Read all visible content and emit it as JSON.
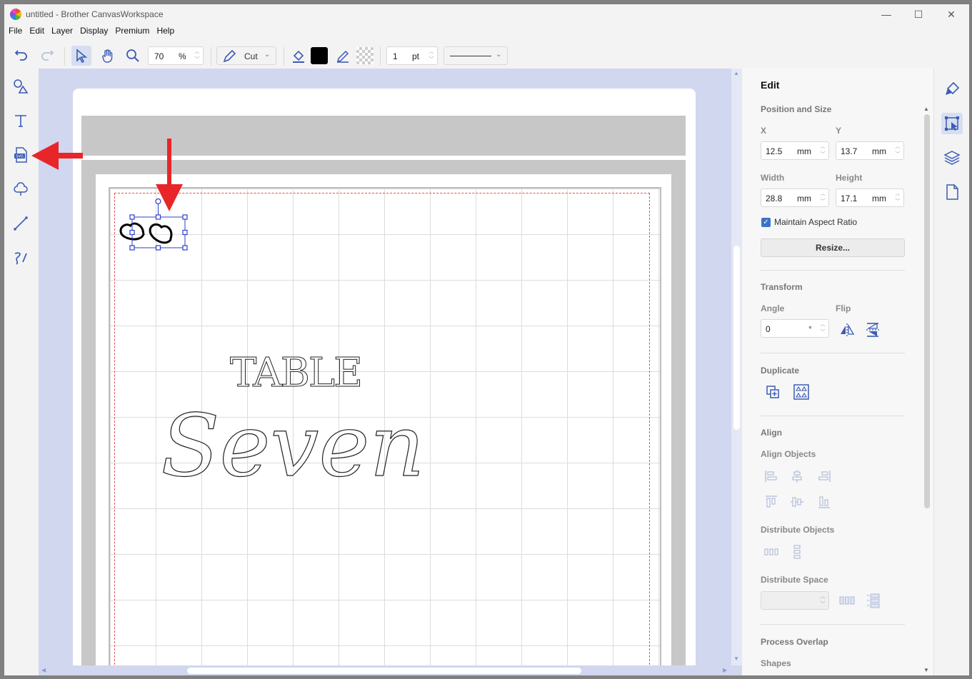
{
  "window": {
    "title": "untitled - Brother CanvasWorkspace",
    "minimize": "—",
    "maximize": "☐",
    "close": "✕"
  },
  "menu": [
    "File",
    "Edit",
    "Layer",
    "Display",
    "Premium",
    "Help"
  ],
  "toolbar": {
    "zoom": {
      "value": "70",
      "unit": "%"
    },
    "mode": "Cut",
    "fill_color": "#000000",
    "line_width": {
      "value": "1",
      "unit": "pt"
    }
  },
  "canvas": {
    "text_line1": "TABLE",
    "text_line2": "Seven"
  },
  "edit_panel": {
    "title": "Edit",
    "position_and_size": "Position and Size",
    "x_label": "X",
    "x_value": "12.5",
    "x_unit": "mm",
    "y_label": "Y",
    "y_value": "13.7",
    "y_unit": "mm",
    "width_label": "Width",
    "width_value": "28.8",
    "width_unit": "mm",
    "height_label": "Height",
    "height_value": "17.1",
    "height_unit": "mm",
    "maintain_aspect": "Maintain Aspect Ratio",
    "resize": "Resize...",
    "transform": "Transform",
    "angle_label": "Angle",
    "angle_value": "0",
    "angle_unit": "°",
    "flip_label": "Flip",
    "duplicate": "Duplicate",
    "align": "Align",
    "align_objects": "Align Objects",
    "distribute_objects": "Distribute Objects",
    "distribute_space": "Distribute Space",
    "process_overlap": "Process Overlap",
    "shapes": "Shapes"
  },
  "colors": {
    "accent": "#3b5bb5",
    "annotation_arrow": "#e8262a"
  }
}
